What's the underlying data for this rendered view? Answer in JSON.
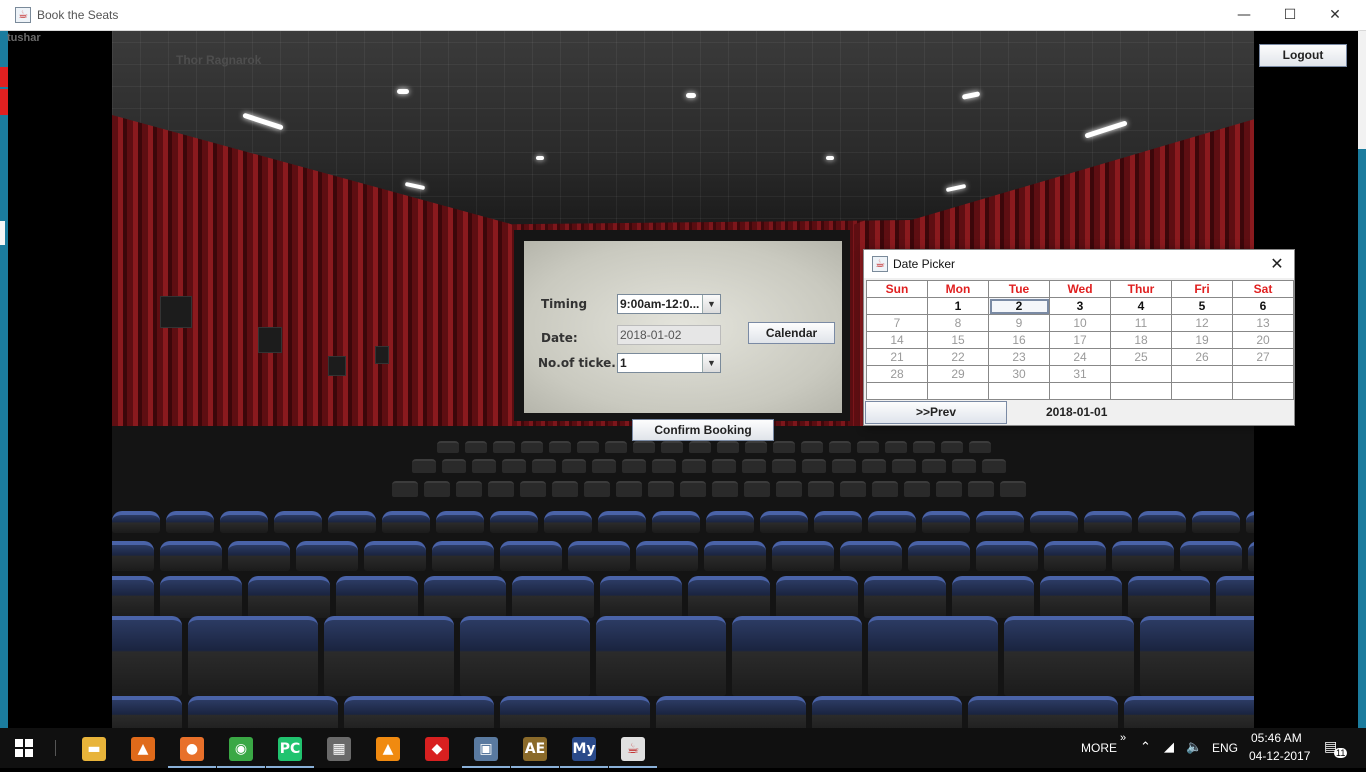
{
  "window": {
    "title": "Book the Seats",
    "minimize": "—",
    "maximize": "☐",
    "close": "✕"
  },
  "user": {
    "name": "tushar"
  },
  "logout_label": "Logout",
  "movie_title": "Thor Ragnarok",
  "form": {
    "timing_label": "Timing",
    "timing_value": "9:00am-12:0...",
    "date_label": "Date:",
    "date_value": "2018-01-02",
    "calendar_button": "Calendar",
    "tickets_label": "No.of ticke...",
    "tickets_value": "1",
    "confirm_button": "Confirm Booking"
  },
  "date_picker": {
    "title": "Date Picker",
    "days": [
      "Sun",
      "Mon",
      "Tue",
      "Wed",
      "Thur",
      "Fri",
      "Sat"
    ],
    "weeks": [
      [
        "",
        "1",
        "2",
        "3",
        "4",
        "5",
        "6"
      ],
      [
        "7",
        "8",
        "9",
        "10",
        "11",
        "12",
        "13"
      ],
      [
        "14",
        "15",
        "16",
        "17",
        "18",
        "19",
        "20"
      ],
      [
        "21",
        "22",
        "23",
        "24",
        "25",
        "26",
        "27"
      ],
      [
        "28",
        "29",
        "30",
        "31",
        "",
        "",
        ""
      ],
      [
        "",
        "",
        "",
        "",
        "",
        "",
        ""
      ]
    ],
    "selected_day": "2",
    "prev_button": ">>Prev",
    "current_date": "2018-01-01"
  },
  "taskbar": {
    "apps": [
      {
        "name": "file-explorer-icon",
        "glyph": "▬",
        "color": "#e8b43a",
        "active": false
      },
      {
        "name": "matlab-icon",
        "glyph": "▲",
        "color": "#e06a1a",
        "active": false
      },
      {
        "name": "firefox-icon",
        "glyph": "●",
        "color": "#e8702a",
        "active": true
      },
      {
        "name": "chrome-icon",
        "glyph": "◉",
        "color": "#3aa845",
        "active": true
      },
      {
        "name": "pycharm-icon",
        "glyph": "PC",
        "color": "#21c36f",
        "active": true
      },
      {
        "name": "calculator-icon",
        "glyph": "▦",
        "color": "#6a6a6a",
        "active": false
      },
      {
        "name": "vlc-icon",
        "glyph": "▲",
        "color": "#f08a10",
        "active": false
      },
      {
        "name": "garena-icon",
        "glyph": "◆",
        "color": "#d82020",
        "active": false
      },
      {
        "name": "teamviewer-icon",
        "glyph": "▣",
        "color": "#5a7aa0",
        "active": true
      },
      {
        "name": "age-of-empires-icon",
        "glyph": "AE",
        "color": "#8a6a2a",
        "active": true
      },
      {
        "name": "mysql-icon",
        "glyph": "My",
        "color": "#2a4a8a",
        "active": true
      },
      {
        "name": "java-icon",
        "glyph": "☕",
        "color": "#e0e0e0",
        "active": true
      }
    ],
    "more_label": "MORE",
    "language": "ENG",
    "time": "05:46 AM",
    "date": "04-12-2017",
    "notifications": "11"
  }
}
